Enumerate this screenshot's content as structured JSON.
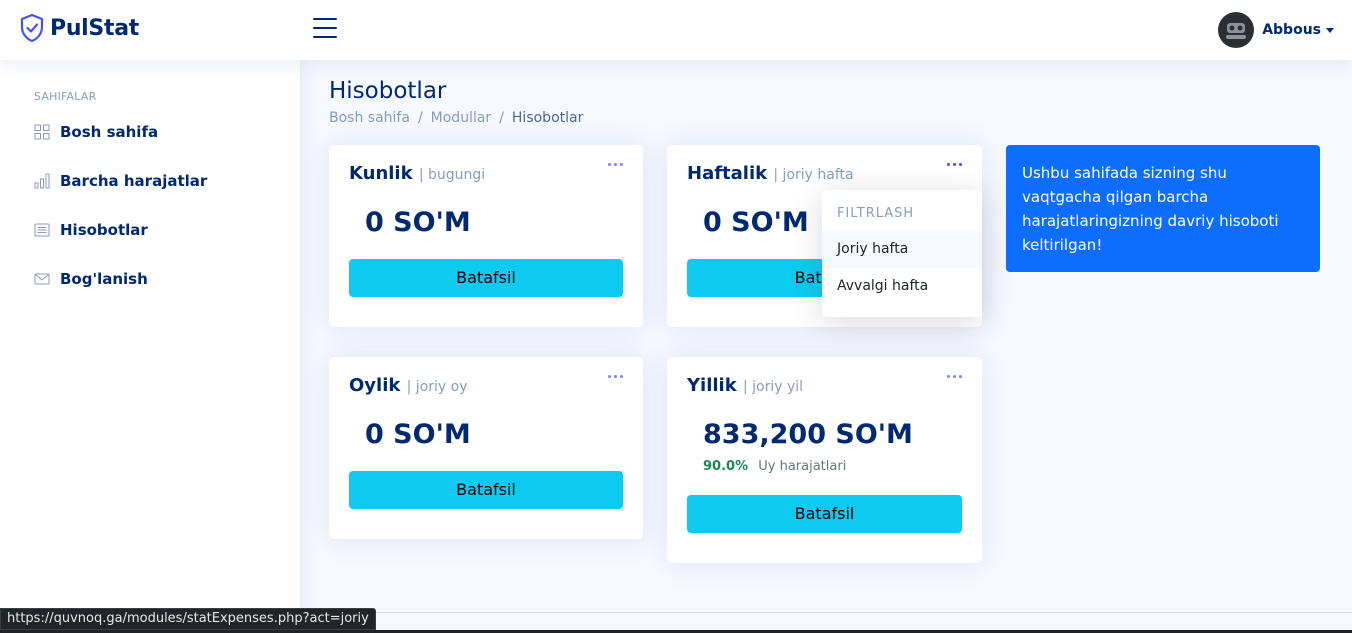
{
  "brand": {
    "name": "PulStat"
  },
  "user": {
    "name": "Abbous"
  },
  "sidebar": {
    "heading": "SAHIFALAR",
    "items": [
      {
        "label": "Bosh sahifa",
        "icon": "grid-icon"
      },
      {
        "label": "Barcha harajatlar",
        "icon": "bar-chart-icon"
      },
      {
        "label": "Hisobotlar",
        "icon": "document-icon"
      },
      {
        "label": "Bog'lanish",
        "icon": "envelope-icon"
      }
    ]
  },
  "page": {
    "title": "Hisobotlar",
    "breadcrumb": [
      "Bosh sahifa",
      "Modullar",
      "Hisobotlar"
    ]
  },
  "cards": [
    {
      "title": "Kunlik",
      "sub": "| bugungi",
      "amount": "0 SO'M",
      "button": "Batafsil"
    },
    {
      "title": "Haftalik",
      "sub": "| joriy hafta",
      "amount": "0 SO'M",
      "button": "Batafsil"
    },
    {
      "title": "Oylik",
      "sub": "| joriy oy",
      "amount": "0 SO'M",
      "button": "Batafsil"
    },
    {
      "title": "Yillik",
      "sub": "| joriy yil",
      "amount": "833,200 SO'M",
      "percent": "90.0%",
      "percent_label": "Uy harajatlari",
      "button": "Batafsil"
    }
  ],
  "dropdown": {
    "header": "FILTRLASH",
    "items": [
      "Joriy hafta",
      "Avvalgi hafta"
    ]
  },
  "info": {
    "text": "Ushbu sahifada sizning shu vaqtgacha qilgan barcha harajatlaringizning davriy hisoboti keltirilgan!"
  },
  "status_url": "https://quvnoq.ga/modules/statExpenses.php?act=joriy",
  "colors": {
    "primary": "#012970",
    "accent": "#0dcaf0",
    "info": "#0d6efd",
    "success": "#198754"
  }
}
